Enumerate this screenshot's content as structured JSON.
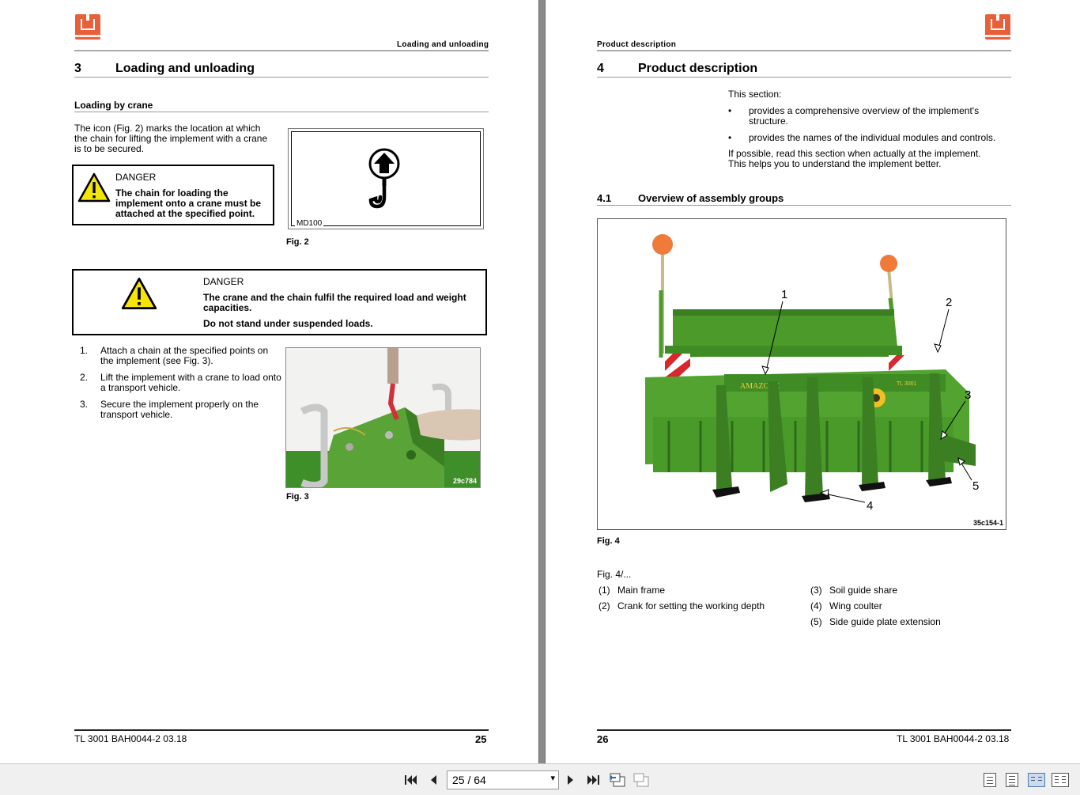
{
  "left_page": {
    "header_right": "Loading and unloading",
    "chapter_number": "3",
    "chapter_title": "Loading and unloading",
    "section_title": "Loading by crane",
    "intro_text": "The icon (Fig. 2) marks the location at which the chain for lifting the implement with a crane is to be secured.",
    "danger1": {
      "label": "DANGER",
      "text": "The chain for loading the implement onto a crane must be attached at the specified point."
    },
    "fig2": {
      "code": "MD100",
      "caption": "Fig. 2"
    },
    "danger2": {
      "label": "DANGER",
      "text1": "The crane and the chain fulfil the required load and weight capacities.",
      "text2": "Do not stand under suspended loads."
    },
    "steps": [
      {
        "num": "1.",
        "text": "Attach a chain at the specified points on the implement (see Fig. 3)."
      },
      {
        "num": "2.",
        "text": "Lift the implement with a crane to load onto a transport vehicle."
      },
      {
        "num": "3.",
        "text": "Secure the implement properly on the transport vehicle."
      }
    ],
    "fig3": {
      "code": "29c784",
      "caption": "Fig. 3"
    },
    "footer_doc": "TL 3001  BAH0044-2  03.18",
    "footer_page": "25"
  },
  "right_page": {
    "header_left": "Product description",
    "chapter_number": "4",
    "chapter_title": "Product description",
    "intro": "This section:",
    "bullets": [
      "provides a comprehensive overview of the implement's structure.",
      "provides the names of the individual modules and controls."
    ],
    "advice": "If possible, read this section when actually at the implement. This helps you to understand the implement better.",
    "section_number": "4.1",
    "section_title": "Overview of assembly groups",
    "fig4": {
      "code": "35c154-1",
      "caption": "Fig. 4",
      "callouts": [
        "1",
        "2",
        "3",
        "4",
        "5"
      ],
      "brand_text": "AMAZONE",
      "model_text": "TL 3001"
    },
    "legend_intro": "Fig. 4/...",
    "legend_left": [
      {
        "num": "(1)",
        "text": "Main frame"
      },
      {
        "num": "(2)",
        "text": "Crank for setting the working depth"
      }
    ],
    "legend_right": [
      {
        "num": "(3)",
        "text": "Soil guide share"
      },
      {
        "num": "(4)",
        "text": "Wing coulter"
      },
      {
        "num": "(5)",
        "text": "Side guide plate extension"
      }
    ],
    "footer_page": "26",
    "footer_doc": "TL 3001  BAH0044-2  03.18"
  },
  "toolbar": {
    "page_display": "25 / 64",
    "icons": [
      "first-page-icon",
      "prev-page-icon",
      "next-page-icon",
      "last-page-icon",
      "go-back-view-icon",
      "go-forward-view-icon",
      "single-page-view-icon",
      "continuous-view-icon",
      "facing-pages-view-icon",
      "continuous-facing-view-icon"
    ]
  },
  "colors": {
    "logo": "#e8603a",
    "machine_green": "#4c9a2a",
    "warning_yellow": "#f4e40a"
  }
}
